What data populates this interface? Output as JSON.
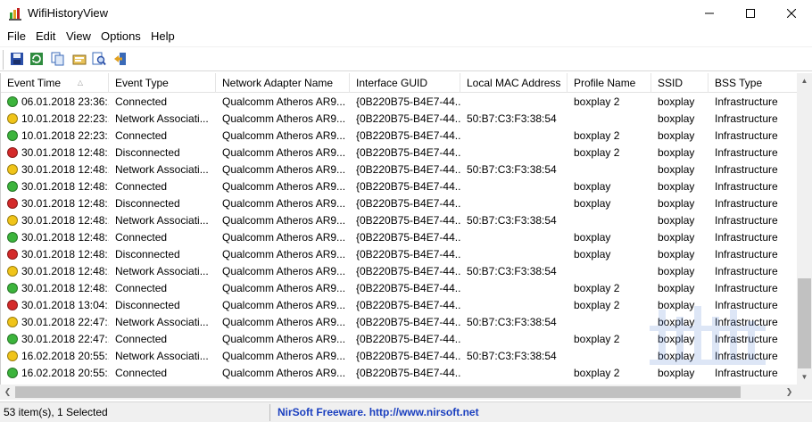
{
  "window": {
    "title": "WifiHistoryView"
  },
  "menu": [
    "File",
    "Edit",
    "View",
    "Options",
    "Help"
  ],
  "toolbar": [
    "save-icon",
    "refresh-icon",
    "copy-icon",
    "properties-icon",
    "find-icon",
    "exit-icon"
  ],
  "columns": [
    "Event Time",
    "Event Type",
    "Network Adapter Name",
    "Interface GUID",
    "Local MAC Address",
    "Profile Name",
    "SSID",
    "BSS Type"
  ],
  "status_colors": {
    "green": "#3cb43c",
    "yellow": "#f0c419",
    "red": "#d42a2a"
  },
  "rows": [
    {
      "status": "green",
      "cells": [
        "06.01.2018 23:36:...",
        "Connected",
        "Qualcomm Atheros AR9...",
        "{0B220B75-B4E7-44...",
        "",
        "boxplay 2",
        "boxplay",
        "Infrastructure"
      ]
    },
    {
      "status": "yellow",
      "cells": [
        "10.01.2018 22:23:...",
        "Network Associati...",
        "Qualcomm Atheros AR9...",
        "{0B220B75-B4E7-44...",
        "50:B7:C3:F3:38:54",
        "",
        "boxplay",
        "Infrastructure"
      ]
    },
    {
      "status": "green",
      "cells": [
        "10.01.2018 22:23:...",
        "Connected",
        "Qualcomm Atheros AR9...",
        "{0B220B75-B4E7-44...",
        "",
        "boxplay 2",
        "boxplay",
        "Infrastructure"
      ]
    },
    {
      "status": "red",
      "cells": [
        "30.01.2018 12:48:...",
        "Disconnected",
        "Qualcomm Atheros AR9...",
        "{0B220B75-B4E7-44...",
        "",
        "boxplay 2",
        "boxplay",
        "Infrastructure"
      ]
    },
    {
      "status": "yellow",
      "cells": [
        "30.01.2018 12:48:...",
        "Network Associati...",
        "Qualcomm Atheros AR9...",
        "{0B220B75-B4E7-44...",
        "50:B7:C3:F3:38:54",
        "",
        "boxplay",
        "Infrastructure"
      ]
    },
    {
      "status": "green",
      "cells": [
        "30.01.2018 12:48:...",
        "Connected",
        "Qualcomm Atheros AR9...",
        "{0B220B75-B4E7-44...",
        "",
        "boxplay",
        "boxplay",
        "Infrastructure"
      ]
    },
    {
      "status": "red",
      "cells": [
        "30.01.2018 12:48:...",
        "Disconnected",
        "Qualcomm Atheros AR9...",
        "{0B220B75-B4E7-44...",
        "",
        "boxplay",
        "boxplay",
        "Infrastructure"
      ]
    },
    {
      "status": "yellow",
      "cells": [
        "30.01.2018 12:48:...",
        "Network Associati...",
        "Qualcomm Atheros AR9...",
        "{0B220B75-B4E7-44...",
        "50:B7:C3:F3:38:54",
        "",
        "boxplay",
        "Infrastructure"
      ]
    },
    {
      "status": "green",
      "cells": [
        "30.01.2018 12:48:...",
        "Connected",
        "Qualcomm Atheros AR9...",
        "{0B220B75-B4E7-44...",
        "",
        "boxplay",
        "boxplay",
        "Infrastructure"
      ]
    },
    {
      "status": "red",
      "cells": [
        "30.01.2018 12:48:...",
        "Disconnected",
        "Qualcomm Atheros AR9...",
        "{0B220B75-B4E7-44...",
        "",
        "boxplay",
        "boxplay",
        "Infrastructure"
      ]
    },
    {
      "status": "yellow",
      "cells": [
        "30.01.2018 12:48:...",
        "Network Associati...",
        "Qualcomm Atheros AR9...",
        "{0B220B75-B4E7-44...",
        "50:B7:C3:F3:38:54",
        "",
        "boxplay",
        "Infrastructure"
      ]
    },
    {
      "status": "green",
      "cells": [
        "30.01.2018 12:48:...",
        "Connected",
        "Qualcomm Atheros AR9...",
        "{0B220B75-B4E7-44...",
        "",
        "boxplay 2",
        "boxplay",
        "Infrastructure"
      ]
    },
    {
      "status": "red",
      "cells": [
        "30.01.2018 13:04:...",
        "Disconnected",
        "Qualcomm Atheros AR9...",
        "{0B220B75-B4E7-44...",
        "",
        "boxplay 2",
        "boxplay",
        "Infrastructure"
      ]
    },
    {
      "status": "yellow",
      "cells": [
        "30.01.2018 22:47:...",
        "Network Associati...",
        "Qualcomm Atheros AR9...",
        "{0B220B75-B4E7-44...",
        "50:B7:C3:F3:38:54",
        "",
        "boxplay",
        "Infrastructure"
      ]
    },
    {
      "status": "green",
      "cells": [
        "30.01.2018 22:47:...",
        "Connected",
        "Qualcomm Atheros AR9...",
        "{0B220B75-B4E7-44...",
        "",
        "boxplay 2",
        "boxplay",
        "Infrastructure"
      ]
    },
    {
      "status": "yellow",
      "cells": [
        "16.02.2018 20:55:...",
        "Network Associati...",
        "Qualcomm Atheros AR9...",
        "{0B220B75-B4E7-44...",
        "50:B7:C3:F3:38:54",
        "",
        "boxplay",
        "Infrastructure"
      ]
    },
    {
      "status": "green",
      "cells": [
        "16.02.2018 20:55:...",
        "Connected",
        "Qualcomm Atheros AR9...",
        "{0B220B75-B4E7-44...",
        "",
        "boxplay 2",
        "boxplay",
        "Infrastructure"
      ]
    }
  ],
  "status_bar": {
    "count": "53 item(s), 1 Selected",
    "link": "NirSoft Freeware.  http://www.nirsoft.net"
  }
}
